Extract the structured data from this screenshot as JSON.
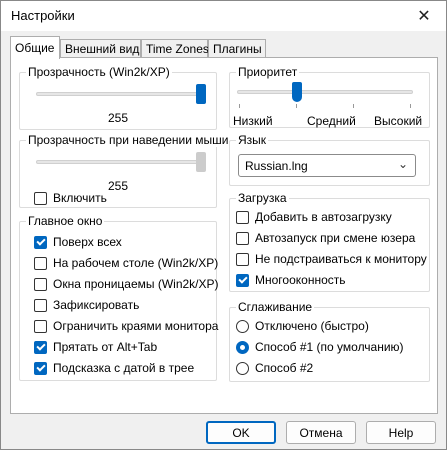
{
  "window": {
    "title": "Настройки",
    "close_glyph": "✕"
  },
  "tabs": [
    {
      "label": "Общие"
    },
    {
      "label": "Внешний вид"
    },
    {
      "label": "Time Zones"
    },
    {
      "label": "Плагины"
    }
  ],
  "transparency": {
    "legend": "Прозрачность (Win2k/XP)",
    "value": "255",
    "level": 1.0
  },
  "hover_transparency": {
    "legend": "Прозрачность при наведении мыши",
    "value": "255",
    "level": 1.0,
    "enable_label": "Включить",
    "enabled": false
  },
  "main_window": {
    "legend": "Главное окно",
    "items": [
      {
        "label": "Поверх всех",
        "checked": true
      },
      {
        "label": "На рабочем столе (Win2k/XP)",
        "checked": false
      },
      {
        "label": "Окна проницаемы (Win2k/XP)",
        "checked": false
      },
      {
        "label": "Зафиксировать",
        "checked": false
      },
      {
        "label": "Ограничить краями монитора",
        "checked": false
      },
      {
        "label": "Прятать  от Alt+Tab",
        "checked": true
      },
      {
        "label": "Подсказка с датой в трее",
        "checked": true
      }
    ]
  },
  "priority": {
    "legend": "Приоритет",
    "low": "Низкий",
    "mid": "Средний",
    "high": "Высокий",
    "level": 0.33
  },
  "language": {
    "legend": "Язык",
    "selected": "Russian.lng"
  },
  "startup": {
    "legend": "Загрузка",
    "items": [
      {
        "label": "Добавить в автозагрузку",
        "checked": false
      },
      {
        "label": "Автозапуск при смене юзера",
        "checked": false
      },
      {
        "label": "Не подстраиваться к монитору",
        "checked": false
      },
      {
        "label": "Многооконность",
        "checked": true
      }
    ]
  },
  "smoothing": {
    "legend": "Сглаживание",
    "options": [
      {
        "label": "Отключено (быстро)",
        "selected": false
      },
      {
        "label": "Способ #1 (по умолчанию)",
        "selected": true
      },
      {
        "label": "Способ #2",
        "selected": false
      }
    ]
  },
  "buttons": {
    "ok": "OK",
    "cancel": "Отмена",
    "help": "Help"
  }
}
